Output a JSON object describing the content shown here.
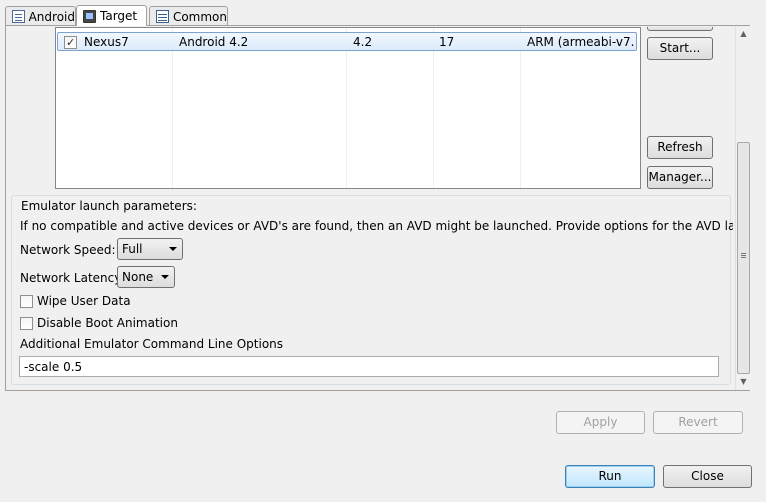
{
  "tabs": [
    {
      "label": "Android",
      "icon": "document-icon"
    },
    {
      "label": "Target",
      "icon": "monitor-icon"
    },
    {
      "label": "Common",
      "icon": "table-icon"
    }
  ],
  "devices": {
    "rows": [
      {
        "checked": true,
        "name": "Nexus7",
        "target": "Android 4.2",
        "platform": "4.2",
        "api": "17",
        "cpu": "ARM (armeabi-v7..."
      }
    ],
    "buttons": {
      "start": "Start...",
      "refresh": "Refresh",
      "manager": "Manager..."
    }
  },
  "emulator": {
    "group_title": "Emulator launch parameters:",
    "description": "If no compatible and active devices or AVD's are found, then an AVD might be launched. Provide options for the AVD launch below.",
    "network_speed_label": "Network Speed:",
    "network_speed_value": "Full",
    "network_latency_label": "Network Latency:",
    "network_latency_value": "None",
    "wipe_user_data_label": "Wipe User Data",
    "wipe_user_data_checked": false,
    "disable_boot_animation_label": "Disable Boot Animation",
    "disable_boot_animation_checked": false,
    "additional_options_label": "Additional Emulator Command Line Options",
    "additional_options_value": "-scale 0.5"
  },
  "actions": {
    "apply": "Apply",
    "revert": "Revert",
    "run": "Run",
    "close": "Close"
  },
  "colors": {
    "selection": "#dcebfc",
    "selection_border": "#7da2ce",
    "default_button": "#3c7fb1"
  }
}
